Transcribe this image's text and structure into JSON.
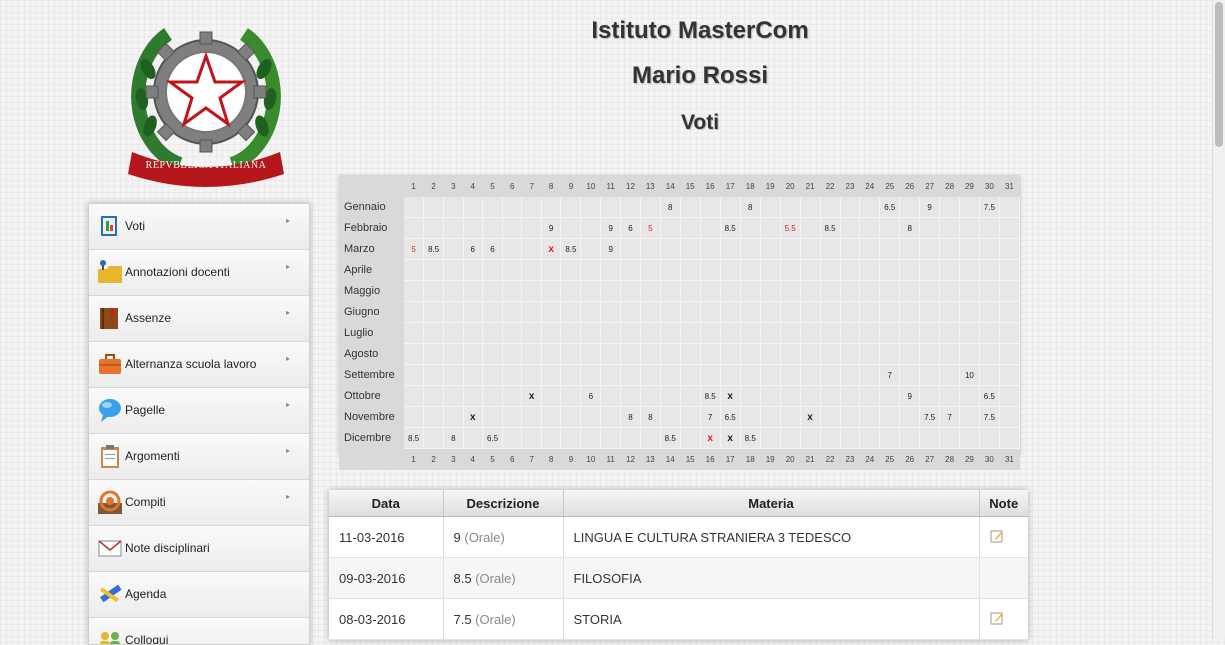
{
  "header": {
    "school": "Istituto MasterCom",
    "student": "Mario Rossi",
    "section": "Voti",
    "emblem_text": "REPVBBLICA ITALIANA"
  },
  "menu": [
    {
      "label": "Voti",
      "icon": "grade-book-icon",
      "submenu": true
    },
    {
      "label": "Annotazioni docenti",
      "icon": "folder-pin-icon",
      "submenu": true
    },
    {
      "label": "Assenze",
      "icon": "absence-book-icon",
      "submenu": true
    },
    {
      "label": "Alternanza scuola lavoro",
      "icon": "briefcase-icon",
      "submenu": true
    },
    {
      "label": "Pagelle",
      "icon": "chat-bubble-icon",
      "submenu": true
    },
    {
      "label": "Argomenti",
      "icon": "clipboard-icon",
      "submenu": true
    },
    {
      "label": "Compiti",
      "icon": "rss-icon",
      "submenu": true
    },
    {
      "label": "Note disciplinari",
      "icon": "envelope-icon",
      "submenu": false
    },
    {
      "label": "Agenda",
      "icon": "pencil-ruler-icon",
      "submenu": false
    },
    {
      "label": "Colloqui",
      "icon": "people-icon",
      "submenu": false
    }
  ],
  "calendar": {
    "days": [
      "1",
      "2",
      "3",
      "4",
      "5",
      "6",
      "7",
      "8",
      "9",
      "10",
      "11",
      "12",
      "13",
      "14",
      "15",
      "16",
      "17",
      "18",
      "19",
      "20",
      "21",
      "22",
      "23",
      "24",
      "25",
      "26",
      "27",
      "28",
      "29",
      "30",
      "31"
    ],
    "months": [
      {
        "name": "Gennaio",
        "cells": {
          "14": "8",
          "18": "8",
          "25": "6.5",
          "27": "9",
          "30": "7.5"
        }
      },
      {
        "name": "Febbraio",
        "cells": {
          "8": "9",
          "11": "9",
          "12": "6",
          "13": "5|r",
          "17": "8.5",
          "20": "5.5|r",
          "22": "8.5",
          "26": "8"
        }
      },
      {
        "name": "Marzo",
        "cells": {
          "1": "5|r",
          "2": "8.5",
          "4": "6",
          "5": "6",
          "8": "x|xr",
          "9": "8.5",
          "11": "9"
        }
      },
      {
        "name": "Aprile",
        "cells": {}
      },
      {
        "name": "Maggio",
        "cells": {}
      },
      {
        "name": "Giugno",
        "cells": {}
      },
      {
        "name": "Luglio",
        "cells": {}
      },
      {
        "name": "Agosto",
        "cells": {}
      },
      {
        "name": "Settembre",
        "cells": {
          "25": "7",
          "29": "10"
        }
      },
      {
        "name": "Ottobre",
        "cells": {
          "7": "x|x",
          "10": "6",
          "16": "8.5",
          "17": "x|x",
          "26": "9",
          "30": "6.5"
        }
      },
      {
        "name": "Novembre",
        "cells": {
          "4": "x|x",
          "12": "8",
          "13": "8",
          "16": "7",
          "17": "6.5",
          "21": "x|x",
          "27": "7.5",
          "28": "7",
          "30": "7.5"
        }
      },
      {
        "name": "Dicembre",
        "cells": {
          "1": "8.5",
          "3": "8",
          "5": "6.5",
          "14": "8.5",
          "16": "x|xr",
          "17": "x|x",
          "18": "8.5"
        }
      }
    ]
  },
  "grades": {
    "headers": {
      "data": "Data",
      "descrizione": "Descrizione",
      "materia": "Materia",
      "note": "Note"
    },
    "rows": [
      {
        "data": "11-03-2016",
        "voto": "9",
        "tipo": "(Orale)",
        "materia": "LINGUA E CULTURA STRANIERA 3 TEDESCO",
        "has_note": true
      },
      {
        "data": "09-03-2016",
        "voto": "8.5",
        "tipo": "(Orale)",
        "materia": "FILOSOFIA",
        "has_note": false
      },
      {
        "data": "08-03-2016",
        "voto": "7.5",
        "tipo": "(Orale)",
        "materia": "STORIA",
        "has_note": true
      }
    ]
  },
  "colors": {
    "red_grade": "#e02020",
    "accent": "#cc2222"
  }
}
